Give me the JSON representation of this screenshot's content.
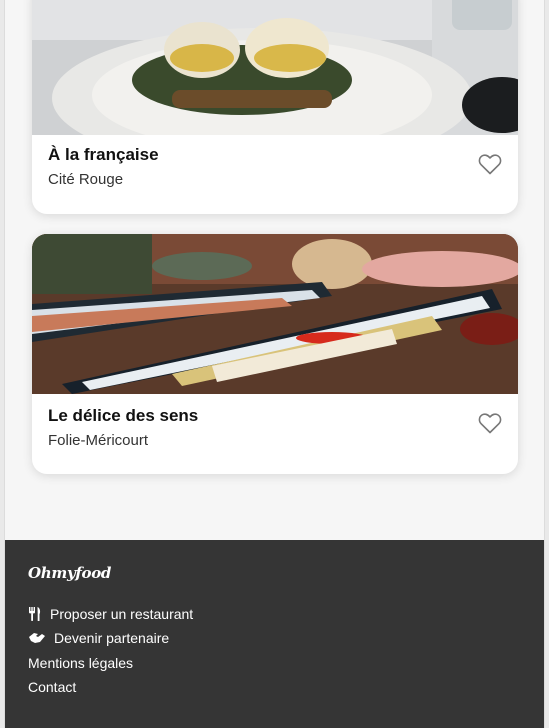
{
  "restaurants": [
    {
      "name": "À la française",
      "neighborhood": "Cité Rouge",
      "image_icon": "eggs-benedict-photo",
      "favorite": false
    },
    {
      "name": "Le délice des sens",
      "neighborhood": "Folie-Méricourt",
      "image_icon": "fish-platter-photo",
      "favorite": false
    }
  ],
  "footer": {
    "brand": "Ohmyfood",
    "links": [
      {
        "label": "Proposer un restaurant",
        "icon": "utensils-icon"
      },
      {
        "label": "Devenir partenaire",
        "icon": "handshake-icon"
      },
      {
        "label": "Mentions légales"
      },
      {
        "label": "Contact"
      }
    ]
  },
  "colors": {
    "footer_bg": "#353535",
    "page_bg": "#f6f6f6",
    "card_bg": "#ffffff",
    "heart_stroke": "#777777"
  }
}
